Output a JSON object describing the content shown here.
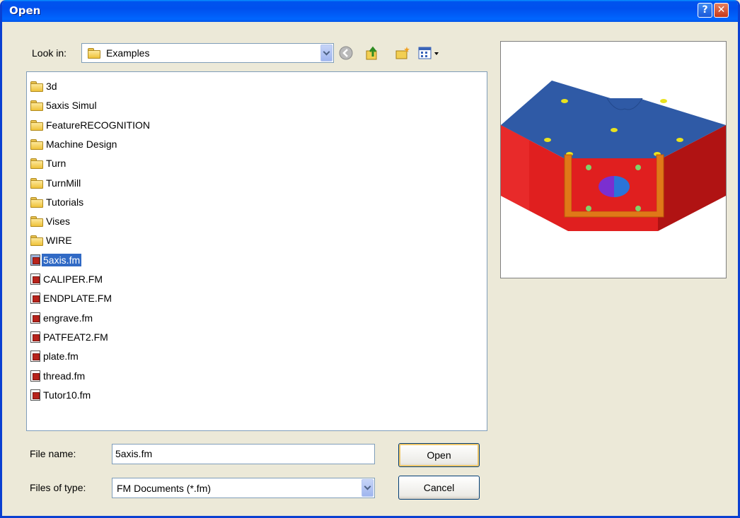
{
  "window": {
    "title": "Open"
  },
  "look_in": {
    "label": "Look in:",
    "value": "Examples",
    "tools": [
      "back-icon",
      "up-one-level-icon",
      "create-new-folder-icon",
      "views-menu-icon"
    ]
  },
  "files": [
    {
      "name": "3d",
      "type": "folder"
    },
    {
      "name": "5axis Simul",
      "type": "folder"
    },
    {
      "name": "FeatureRECOGNITION",
      "type": "folder"
    },
    {
      "name": "Machine Design",
      "type": "folder"
    },
    {
      "name": "Turn",
      "type": "folder"
    },
    {
      "name": "TurnMill",
      "type": "folder"
    },
    {
      "name": "Tutorials",
      "type": "folder"
    },
    {
      "name": "Vises",
      "type": "folder"
    },
    {
      "name": "WIRE",
      "type": "folder"
    },
    {
      "name": "5axis.fm",
      "type": "fm",
      "selected": true
    },
    {
      "name": "CALIPER.FM",
      "type": "fm"
    },
    {
      "name": "ENDPLATE.FM",
      "type": "fm"
    },
    {
      "name": "engrave.fm",
      "type": "fm"
    },
    {
      "name": "PATFEAT2.FM",
      "type": "fm"
    },
    {
      "name": "plate.fm",
      "type": "fm"
    },
    {
      "name": "thread.fm",
      "type": "fm"
    },
    {
      "name": "Tutor10.fm",
      "type": "fm"
    }
  ],
  "file_name": {
    "label": "File name:",
    "value": "5axis.fm"
  },
  "file_type": {
    "label": "Files of type:",
    "value": "FM Documents (*.fm)"
  },
  "buttons": {
    "open": "Open",
    "cancel": "Cancel"
  },
  "colors": {
    "titlebar": "#0054e3",
    "selection": "#316ac5",
    "part_top": "#2f5aa6",
    "part_side": "#e01f1f",
    "part_channel": "#e07818"
  }
}
